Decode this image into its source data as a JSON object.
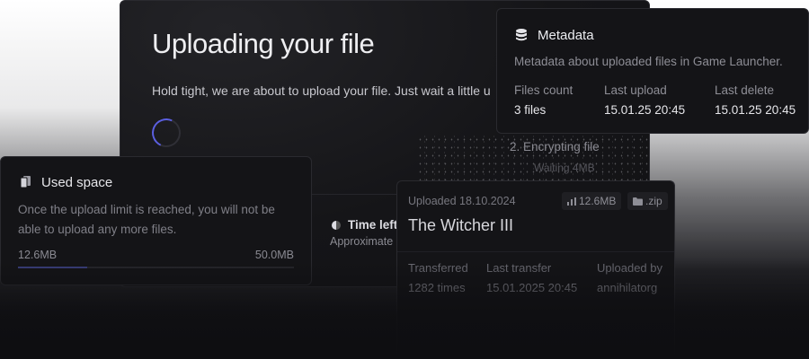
{
  "upload": {
    "title": "Uploading your file",
    "subtitle": "Hold tight, we are about to upload your file. Just wait a little u",
    "step_current": "2. Encrypting file",
    "step_detail": "Waiting 4MB",
    "time_left_label": "Time left",
    "approx_label": "Approximate"
  },
  "used_space": {
    "title": "Used space",
    "icon": "file-stack-icon",
    "description": "Once the upload limit is reached, you will not be able to upload any more files.",
    "used": "12.6MB",
    "limit": "50.0MB",
    "fill_fraction": 0.252,
    "accent": "#3a3f7c"
  },
  "metadata": {
    "title": "Metadata",
    "icon": "database-icon",
    "description": "Metadata about uploaded files in Game Launcher.",
    "columns": [
      {
        "label": "Files count",
        "value": "3 files"
      },
      {
        "label": "Last upload",
        "value": "15.01.25 20:45"
      },
      {
        "label": "Last delete",
        "value": "15.01.25 20:45"
      }
    ]
  },
  "file": {
    "uploaded": "Uploaded 18.10.2024",
    "size": "12.6MB",
    "extension": ".zip",
    "name": "The Witcher III",
    "columns": [
      {
        "label": "Transferred",
        "value": "1282 times"
      },
      {
        "label": "Last transfer",
        "value": "15.01.2025 20:45"
      },
      {
        "label": "Uploaded by",
        "value": "annihilatorg"
      }
    ]
  },
  "colors": {
    "spinner": "#5b5fe0",
    "card_bg": "#141417"
  }
}
